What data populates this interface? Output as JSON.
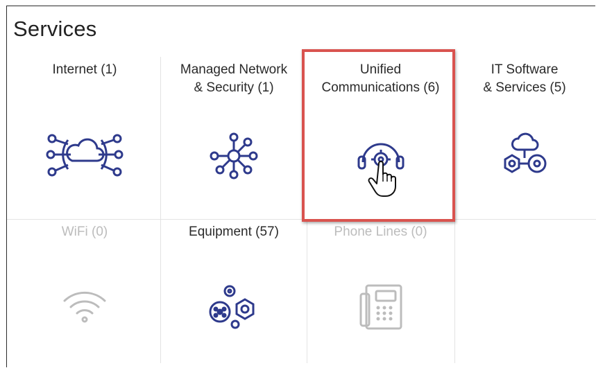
{
  "page": {
    "title": "Services"
  },
  "colors": {
    "icon": "#2e3a8c",
    "disabled": "#bcbcbc",
    "highlight": "#d9534f"
  },
  "tiles": [
    {
      "label_line1": "Internet (1)",
      "label_line2": "",
      "icon": "cloud-network-icon",
      "disabled": false
    },
    {
      "label_line1": "Managed Network",
      "label_line2": "& Security (1)",
      "icon": "network-hub-icon",
      "disabled": false
    },
    {
      "label_line1": "Unified",
      "label_line2": "Communications (6)",
      "icon": "headset-gear-icon",
      "disabled": false,
      "highlighted": true
    },
    {
      "label_line1": "IT Software",
      "label_line2": "& Services (5)",
      "icon": "cloud-gears-icon",
      "disabled": false
    },
    {
      "label_line1": "WiFi (0)",
      "label_line2": "",
      "icon": "wifi-icon",
      "disabled": true
    },
    {
      "label_line1": "Equipment (57)",
      "label_line2": "",
      "icon": "equipment-gears-icon",
      "disabled": false
    },
    {
      "label_line1": "Phone Lines (0)",
      "label_line2": "",
      "icon": "desk-phone-icon",
      "disabled": true
    }
  ]
}
